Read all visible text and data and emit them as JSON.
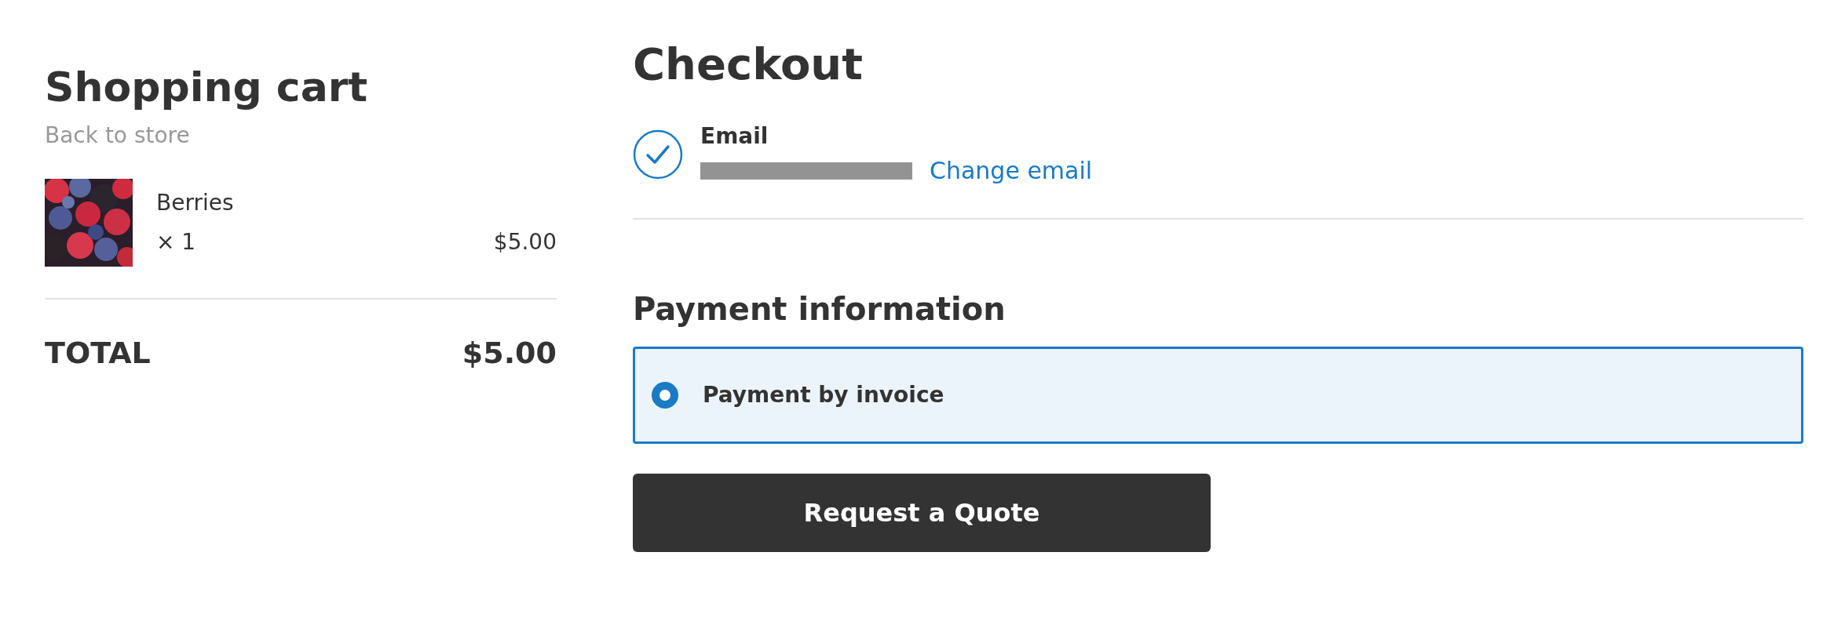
{
  "cart": {
    "title": "Shopping cart",
    "back_link": "Back to store",
    "items": [
      {
        "name": "Berries",
        "quantity": "× 1",
        "price": "$5.00",
        "kind": "picture"
      }
    ],
    "total_label": "TOTAL",
    "total": "$5.00"
  },
  "checkout": {
    "title": "Checkout",
    "email": {
      "label": "Email",
      "verified": true,
      "redacted": true,
      "change_link": "Change email"
    },
    "payment_title": "Payment information",
    "payment_methods": [
      {
        "label": "Payment by invoice",
        "selected": true
      }
    ],
    "submit": "Request a Quote"
  }
}
